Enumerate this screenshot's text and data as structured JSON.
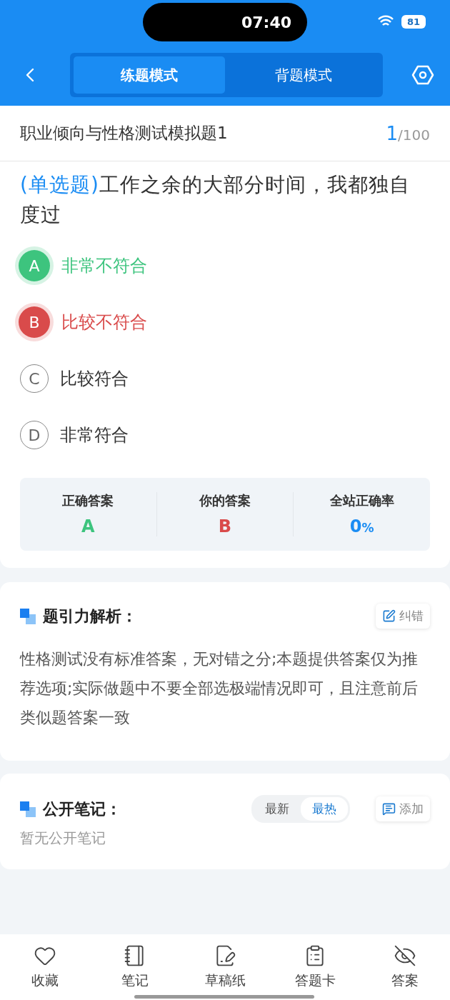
{
  "status_bar": {
    "time": "07:40",
    "battery": "81"
  },
  "nav": {
    "tabs": [
      {
        "label": "练题模式",
        "selected": true
      },
      {
        "label": "背题模式",
        "selected": false
      }
    ]
  },
  "exam": {
    "title": "职业倾向与性格测试模拟题1",
    "current": "1",
    "total": "/100"
  },
  "question": {
    "type": "(单选题)",
    "text": "工作之余的大部分时间，我都独自度过"
  },
  "options": [
    {
      "letter": "A",
      "text": "非常不符合",
      "correct": true,
      "selected": false
    },
    {
      "letter": "B",
      "text": "比较不符合",
      "correct": false,
      "selected": true
    },
    {
      "letter": "C",
      "text": "比较符合",
      "correct": false,
      "selected": false
    },
    {
      "letter": "D",
      "text": "非常符合",
      "correct": false,
      "selected": false
    }
  ],
  "stats": [
    {
      "label": "正确答案",
      "value": "A",
      "kind": "correct"
    },
    {
      "label": "你的答案",
      "value": "B",
      "kind": "wrong"
    },
    {
      "label": "全站正确率",
      "value": "0",
      "unit": "%",
      "kind": "rate"
    }
  ],
  "analysis": {
    "title": "题引力解析：",
    "button": "纠错",
    "text": "性格测试没有标准答案，无对错之分;本题提供答案仅为推荐选项;实际做题中不要全部选极端情况即可，且注意前后类似题答案一致"
  },
  "notes": {
    "title": "公开笔记：",
    "sort": [
      {
        "label": "最新",
        "selected": false
      },
      {
        "label": "最热",
        "selected": true
      }
    ],
    "button": "添加",
    "empty": "暂无公开笔记"
  },
  "bottom_bar": [
    {
      "kind": "heart",
      "label": "收藏"
    },
    {
      "kind": "notebook",
      "label": "笔记"
    },
    {
      "kind": "draft",
      "label": "草稿纸"
    },
    {
      "kind": "clipboard",
      "label": "答题卡"
    },
    {
      "kind": "eye-off",
      "label": "答案"
    }
  ]
}
